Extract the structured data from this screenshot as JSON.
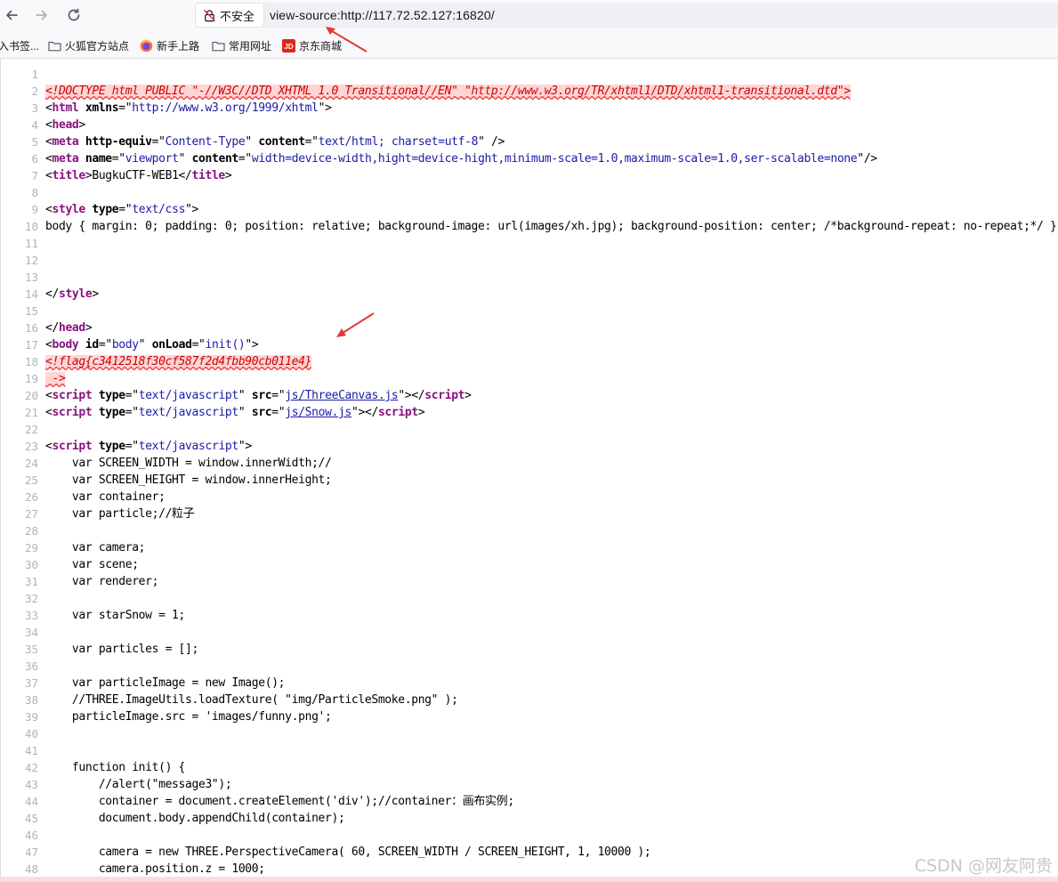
{
  "browser": {
    "security_label": "不安全",
    "url": "view-source:http://117.72.52.127:16820/"
  },
  "bookmarks": [
    {
      "label": "入书签...",
      "icon": "bookmark-icon"
    },
    {
      "label": "火狐官方站点",
      "icon": "folder-icon"
    },
    {
      "label": "新手上路",
      "icon": "firefox-icon"
    },
    {
      "label": "常用网址",
      "icon": "folder-icon"
    },
    {
      "label": "京东商城",
      "icon": "jd-icon"
    }
  ],
  "source": {
    "lines": [
      {
        "n": "1",
        "segments": []
      },
      {
        "n": "2",
        "segments": [
          {
            "t": "<!DOCTYPE html PUBLIC \"-//W3C//DTD XHTML 1.0 Transitional//EN\" \"http://www.w3.org/TR/xhtml1/DTD/xhtml1-transitional.dtd\">",
            "c": "err"
          }
        ]
      },
      {
        "n": "3",
        "segments": [
          {
            "t": "<",
            "c": "punct"
          },
          {
            "t": "html ",
            "c": "tag"
          },
          {
            "t": "xmlns",
            "c": "attr"
          },
          {
            "t": "=\"",
            "c": "punct"
          },
          {
            "t": "http://www.w3.org/1999/xhtml",
            "c": "val"
          },
          {
            "t": "\">",
            "c": "punct"
          }
        ]
      },
      {
        "n": "4",
        "segments": [
          {
            "t": "<",
            "c": "punct"
          },
          {
            "t": "head",
            "c": "tag"
          },
          {
            "t": ">",
            "c": "punct"
          }
        ]
      },
      {
        "n": "5",
        "segments": [
          {
            "t": "<",
            "c": "punct"
          },
          {
            "t": "meta ",
            "c": "tag"
          },
          {
            "t": "http-equiv",
            "c": "attr"
          },
          {
            "t": "=\"",
            "c": "punct"
          },
          {
            "t": "Content-Type",
            "c": "val"
          },
          {
            "t": "\" ",
            "c": "punct"
          },
          {
            "t": "content",
            "c": "attr"
          },
          {
            "t": "=\"",
            "c": "punct"
          },
          {
            "t": "text/html; charset=utf-8",
            "c": "val"
          },
          {
            "t": "\" />",
            "c": "punct"
          }
        ]
      },
      {
        "n": "6",
        "segments": [
          {
            "t": "<",
            "c": "punct"
          },
          {
            "t": "meta ",
            "c": "tag"
          },
          {
            "t": "name",
            "c": "attr"
          },
          {
            "t": "=\"",
            "c": "punct"
          },
          {
            "t": "viewport",
            "c": "val"
          },
          {
            "t": "\" ",
            "c": "punct"
          },
          {
            "t": "content",
            "c": "attr"
          },
          {
            "t": "=\"",
            "c": "punct"
          },
          {
            "t": "width=device-width,hight=device-hight,minimum-scale=1.0,maximum-scale=1.0,ser-scalable=none",
            "c": "val"
          },
          {
            "t": "\"/>",
            "c": "punct"
          }
        ]
      },
      {
        "n": "7",
        "segments": [
          {
            "t": "<",
            "c": "punct"
          },
          {
            "t": "title",
            "c": "tag"
          },
          {
            "t": ">BugkuCTF-WEB1</",
            "c": "punct"
          },
          {
            "t": "title",
            "c": "tag"
          },
          {
            "t": ">",
            "c": "punct"
          }
        ]
      },
      {
        "n": "8",
        "segments": []
      },
      {
        "n": "9",
        "segments": [
          {
            "t": "<",
            "c": "punct"
          },
          {
            "t": "style ",
            "c": "tag"
          },
          {
            "t": "type",
            "c": "attr"
          },
          {
            "t": "=\"",
            "c": "punct"
          },
          {
            "t": "text/css",
            "c": "val"
          },
          {
            "t": "\">",
            "c": "punct"
          }
        ]
      },
      {
        "n": "10",
        "segments": [
          {
            "t": "body { margin: 0; padding: 0; position: relative; background-image: url(images/xh.jpg); background-position: center; /*background-repeat: no-repeat;*/ }",
            "c": "cmt"
          }
        ]
      },
      {
        "n": "11",
        "segments": []
      },
      {
        "n": "12",
        "segments": []
      },
      {
        "n": "13",
        "segments": []
      },
      {
        "n": "14",
        "segments": [
          {
            "t": "</",
            "c": "punct"
          },
          {
            "t": "style",
            "c": "tag"
          },
          {
            "t": ">",
            "c": "punct"
          }
        ]
      },
      {
        "n": "15",
        "segments": []
      },
      {
        "n": "16",
        "segments": [
          {
            "t": "</",
            "c": "punct"
          },
          {
            "t": "head",
            "c": "tag"
          },
          {
            "t": ">",
            "c": "punct"
          }
        ]
      },
      {
        "n": "17",
        "segments": [
          {
            "t": "<",
            "c": "punct"
          },
          {
            "t": "body ",
            "c": "tag"
          },
          {
            "t": "id",
            "c": "attr"
          },
          {
            "t": "=\"",
            "c": "punct"
          },
          {
            "t": "body",
            "c": "val"
          },
          {
            "t": "\" ",
            "c": "punct"
          },
          {
            "t": "onLoad",
            "c": "attr"
          },
          {
            "t": "=\"",
            "c": "punct"
          },
          {
            "t": "init()",
            "c": "val"
          },
          {
            "t": "\">",
            "c": "punct"
          }
        ]
      },
      {
        "n": "18",
        "segments": [
          {
            "t": "<!flag{c3412518f30cf587f2d4fbb90cb011e4}",
            "c": "err"
          }
        ]
      },
      {
        "n": "19",
        "segments": [
          {
            "t": " ->",
            "c": "err"
          }
        ]
      },
      {
        "n": "20",
        "segments": [
          {
            "t": "<",
            "c": "punct"
          },
          {
            "t": "script ",
            "c": "tag"
          },
          {
            "t": "type",
            "c": "attr"
          },
          {
            "t": "=\"",
            "c": "punct"
          },
          {
            "t": "text/javascript",
            "c": "val"
          },
          {
            "t": "\" ",
            "c": "punct"
          },
          {
            "t": "src",
            "c": "attr"
          },
          {
            "t": "=\"",
            "c": "punct"
          },
          {
            "t": "js/ThreeCanvas.js",
            "c": "link"
          },
          {
            "t": "\"></",
            "c": "punct"
          },
          {
            "t": "script",
            "c": "tag"
          },
          {
            "t": ">",
            "c": "punct"
          }
        ]
      },
      {
        "n": "21",
        "segments": [
          {
            "t": "<",
            "c": "punct"
          },
          {
            "t": "script ",
            "c": "tag"
          },
          {
            "t": "type",
            "c": "attr"
          },
          {
            "t": "=\"",
            "c": "punct"
          },
          {
            "t": "text/javascript",
            "c": "val"
          },
          {
            "t": "\" ",
            "c": "punct"
          },
          {
            "t": "src",
            "c": "attr"
          },
          {
            "t": "=\"",
            "c": "punct"
          },
          {
            "t": "js/Snow.js",
            "c": "link"
          },
          {
            "t": "\"></",
            "c": "punct"
          },
          {
            "t": "script",
            "c": "tag"
          },
          {
            "t": ">",
            "c": "punct"
          }
        ]
      },
      {
        "n": "22",
        "segments": []
      },
      {
        "n": "23",
        "segments": [
          {
            "t": "<",
            "c": "punct"
          },
          {
            "t": "script ",
            "c": "tag"
          },
          {
            "t": "type",
            "c": "attr"
          },
          {
            "t": "=\"",
            "c": "punct"
          },
          {
            "t": "text/javascript",
            "c": "val"
          },
          {
            "t": "\">",
            "c": "punct"
          }
        ]
      },
      {
        "n": "24",
        "segments": [
          {
            "t": "    var SCREEN_WIDTH = window.innerWidth;//",
            "c": "cmt"
          }
        ]
      },
      {
        "n": "25",
        "segments": [
          {
            "t": "    var SCREEN_HEIGHT = window.innerHeight;",
            "c": "cmt"
          }
        ]
      },
      {
        "n": "26",
        "segments": [
          {
            "t": "    var container;",
            "c": "cmt"
          }
        ]
      },
      {
        "n": "27",
        "segments": [
          {
            "t": "    var particle;//粒子",
            "c": "cmt"
          }
        ]
      },
      {
        "n": "28",
        "segments": []
      },
      {
        "n": "29",
        "segments": [
          {
            "t": "    var camera;",
            "c": "cmt"
          }
        ]
      },
      {
        "n": "30",
        "segments": [
          {
            "t": "    var scene;",
            "c": "cmt"
          }
        ]
      },
      {
        "n": "31",
        "segments": [
          {
            "t": "    var renderer;",
            "c": "cmt"
          }
        ]
      },
      {
        "n": "32",
        "segments": []
      },
      {
        "n": "33",
        "segments": [
          {
            "t": "    var starSnow = 1;",
            "c": "cmt"
          }
        ]
      },
      {
        "n": "34",
        "segments": []
      },
      {
        "n": "35",
        "segments": [
          {
            "t": "    var particles = [];",
            "c": "cmt"
          }
        ]
      },
      {
        "n": "36",
        "segments": []
      },
      {
        "n": "37",
        "segments": [
          {
            "t": "    var particleImage = new Image();",
            "c": "cmt"
          }
        ]
      },
      {
        "n": "38",
        "segments": [
          {
            "t": "    //THREE.ImageUtils.loadTexture( \"img/ParticleSmoke.png\" );",
            "c": "cmt"
          }
        ]
      },
      {
        "n": "39",
        "segments": [
          {
            "t": "    particleImage.src = 'images/funny.png';",
            "c": "cmt"
          }
        ]
      },
      {
        "n": "40",
        "segments": []
      },
      {
        "n": "41",
        "segments": []
      },
      {
        "n": "42",
        "segments": [
          {
            "t": "    function init() {",
            "c": "cmt"
          }
        ]
      },
      {
        "n": "43",
        "segments": [
          {
            "t": "        //alert(\"message3\");",
            "c": "cmt"
          }
        ]
      },
      {
        "n": "44",
        "segments": [
          {
            "t": "        container = document.createElement('div');//container：画布实例;",
            "c": "cmt"
          }
        ]
      },
      {
        "n": "45",
        "segments": [
          {
            "t": "        document.body.appendChild(container);",
            "c": "cmt"
          }
        ]
      },
      {
        "n": "46",
        "segments": []
      },
      {
        "n": "47",
        "segments": [
          {
            "t": "        camera = new THREE.PerspectiveCamera( 60, SCREEN_WIDTH / SCREEN_HEIGHT, 1, 10000 );",
            "c": "cmt"
          }
        ]
      },
      {
        "n": "48",
        "segments": [
          {
            "t": "        camera.position.z = 1000;",
            "c": "cmt"
          }
        ]
      }
    ]
  },
  "watermark": "CSDN @网友阿贵",
  "colors": {
    "tag": "#881280",
    "value": "#1a1aa6",
    "error_bg": "#ffd5d5",
    "line_number": "#b3b3b3",
    "annotation_arrow": "#e53935"
  }
}
